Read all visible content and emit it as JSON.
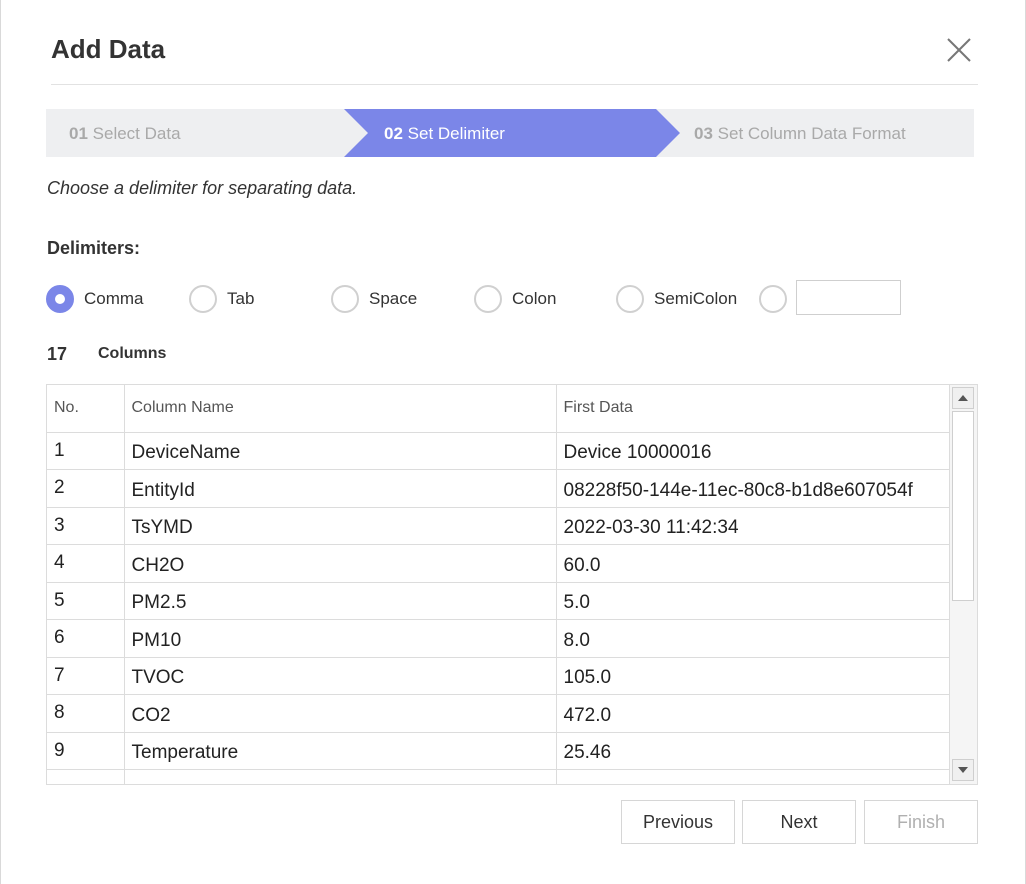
{
  "dialog": {
    "title": "Add Data"
  },
  "steps": [
    {
      "num": "01",
      "label": "Select Data",
      "state": "done"
    },
    {
      "num": "02",
      "label": "Set Delimiter",
      "state": "active"
    },
    {
      "num": "03",
      "label": "Set Column Data Format",
      "state": "pending"
    }
  ],
  "hint": "Choose a delimiter for separating data.",
  "delimiters": {
    "label": "Delimiters:",
    "options": [
      {
        "label": "Comma",
        "checked": true
      },
      {
        "label": "Tab",
        "checked": false
      },
      {
        "label": "Space",
        "checked": false
      },
      {
        "label": "Colon",
        "checked": false
      },
      {
        "label": "SemiColon",
        "checked": false
      },
      {
        "label": "",
        "checked": false
      }
    ],
    "custom_value": ""
  },
  "columns": {
    "count": "17",
    "label": "Columns"
  },
  "table": {
    "headers": [
      "No.",
      "Column Name",
      "First Data"
    ],
    "rows": [
      [
        "1",
        "DeviceName",
        "Device 10000016"
      ],
      [
        "2",
        "EntityId",
        "08228f50-144e-11ec-80c8-b1d8e607054f"
      ],
      [
        "3",
        "TsYMD",
        "2022-03-30 11:42:34"
      ],
      [
        "4",
        "CH2O",
        "60.0"
      ],
      [
        "5",
        "PM2.5",
        "5.0"
      ],
      [
        "6",
        "PM10",
        "8.0"
      ],
      [
        "7",
        "TVOC",
        "105.0"
      ],
      [
        "8",
        "CO2",
        "472.0"
      ],
      [
        "9",
        "Temperature",
        "25.46"
      ]
    ]
  },
  "footer": {
    "previous": "Previous",
    "next": "Next",
    "finish": "Finish"
  },
  "colors": {
    "accent": "#7b86e8",
    "step_inactive_bg": "#eeeff1"
  }
}
